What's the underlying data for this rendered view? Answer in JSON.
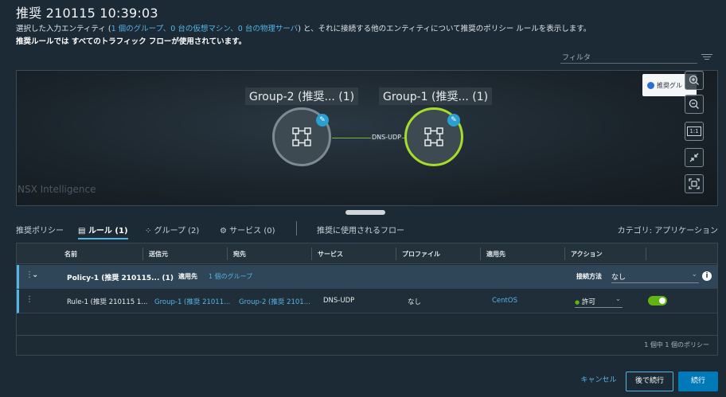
{
  "header": {
    "title": "推奨 210115 10:39:03",
    "desc_line1_pre": "選択した入力エンティティ (",
    "desc_line1_link": "1 個のグループ、0 台の仮想マシン、0 台の物理サーバ",
    "desc_line1_post": ") と、それに接続する他のエンティティについて推奨のポリシー ルールを表示します。",
    "desc_line2_pre": "推奨ルールでは ",
    "desc_line2_bold": "すべてのトラフィック",
    "desc_line2_post": " フローが使用されています。",
    "filter_placeholder": "フィルタ"
  },
  "canvas": {
    "watermark": "NSX Intelligence",
    "legend_label": "推奨グル",
    "nodes": [
      {
        "label": "Group-2 (推奨... (1)"
      },
      {
        "label": "Group-1 (推奨... (1)"
      }
    ],
    "edge_label": "DNS-UDP",
    "tools": [
      "zoom-in",
      "zoom-out",
      "1:1",
      "collapse",
      "fit"
    ],
    "tool_1to1_label": "1:1"
  },
  "tabs": {
    "policy_label": "推奨ポリシー",
    "items": [
      {
        "label": "ルール (1)"
      },
      {
        "label": "グループ (2)"
      },
      {
        "label": "サービス (0)"
      }
    ],
    "flows_label": "推奨に使用されるフロー",
    "category": "カテゴリ: アプリケーション"
  },
  "table": {
    "columns": [
      "名前",
      "送信元",
      "宛先",
      "サービス",
      "プロファイル",
      "適用先",
      "アクション"
    ],
    "policy": {
      "name": "Policy-1 (推奨 210115... (1)",
      "applied_label": "適用先",
      "applied_value": "1 個のグループ",
      "connection_label": "接続方法",
      "connection_value": "なし"
    },
    "rule": {
      "name": "Rule-1 (推奨 210115 1...",
      "source": "Group-1 (推奨 21011...",
      "destination": "Group-2 (推奨 2101...",
      "service": "DNS-UDP",
      "profile": "なし",
      "applied_to": "CentOS",
      "action": "許可"
    },
    "pager": "1 個中 1 個のポリシー"
  },
  "footer": {
    "cancel": "キャンセル",
    "later": "後で続行",
    "continue": "続行"
  }
}
